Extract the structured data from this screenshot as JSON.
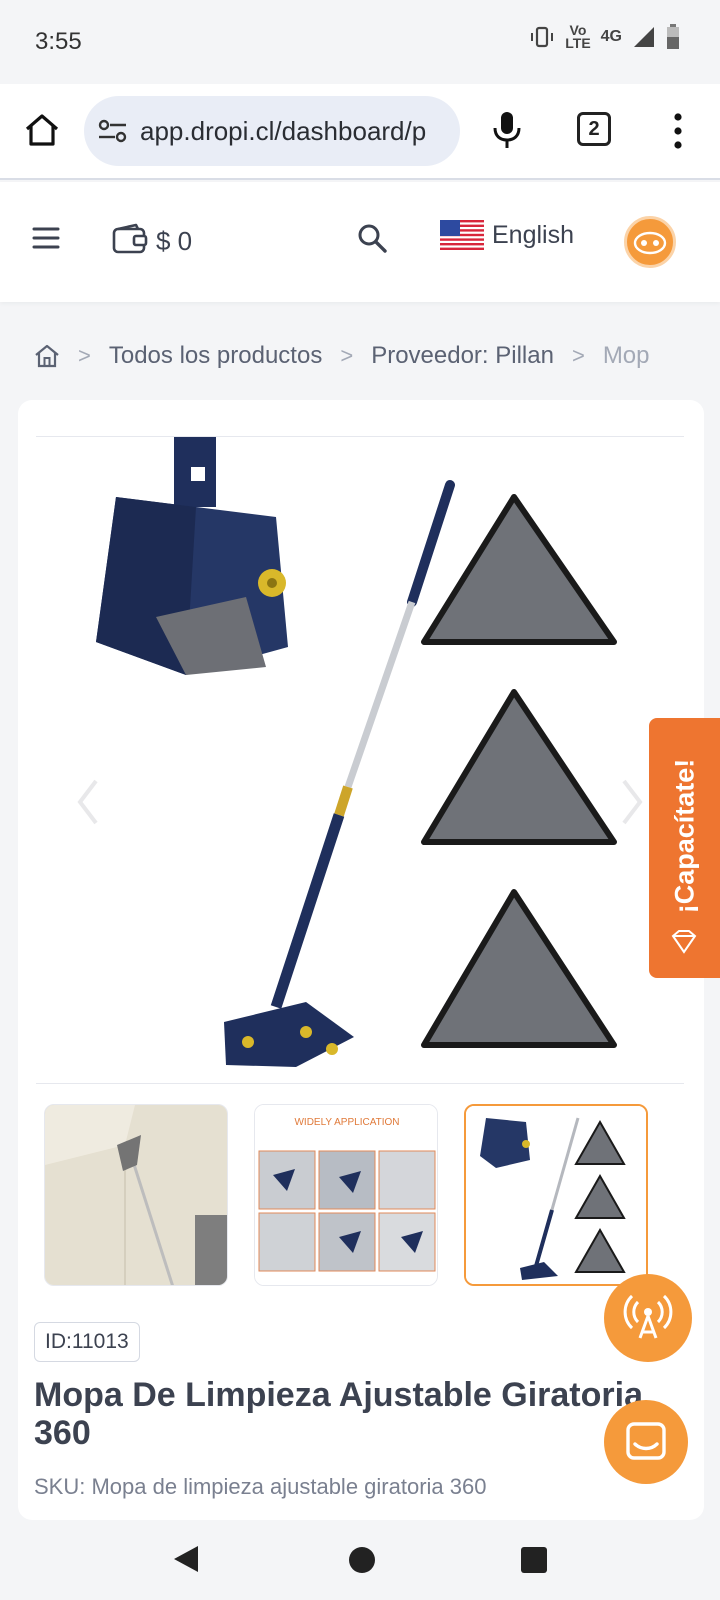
{
  "status_bar": {
    "time": "3:55",
    "network_top": "Vo",
    "network_bottom": "LTE",
    "signal_type": "4G"
  },
  "browser": {
    "url": "app.dropi.cl/dashboard/p",
    "tab_count": "2"
  },
  "header": {
    "wallet_amount": "$ 0",
    "language": "English"
  },
  "breadcrumb": {
    "items": [
      "Todos los productos",
      "Proveedor: Pillan",
      "Mop"
    ]
  },
  "product": {
    "id_label": "ID:11013",
    "title": "Mopa De Limpieza Ajustable Giratoria 360",
    "sku": "SKU: Mopa de limpieza ajustable giratoria 360",
    "thumb2_heading": "WIDELY APPLICATION"
  },
  "floating": {
    "capacitate_label": "¡Capacítate!"
  },
  "colors": {
    "accent_orange": "#f59a3b",
    "capacitate_orange": "#ee7530",
    "mop_navy": "#1f2f5c"
  }
}
